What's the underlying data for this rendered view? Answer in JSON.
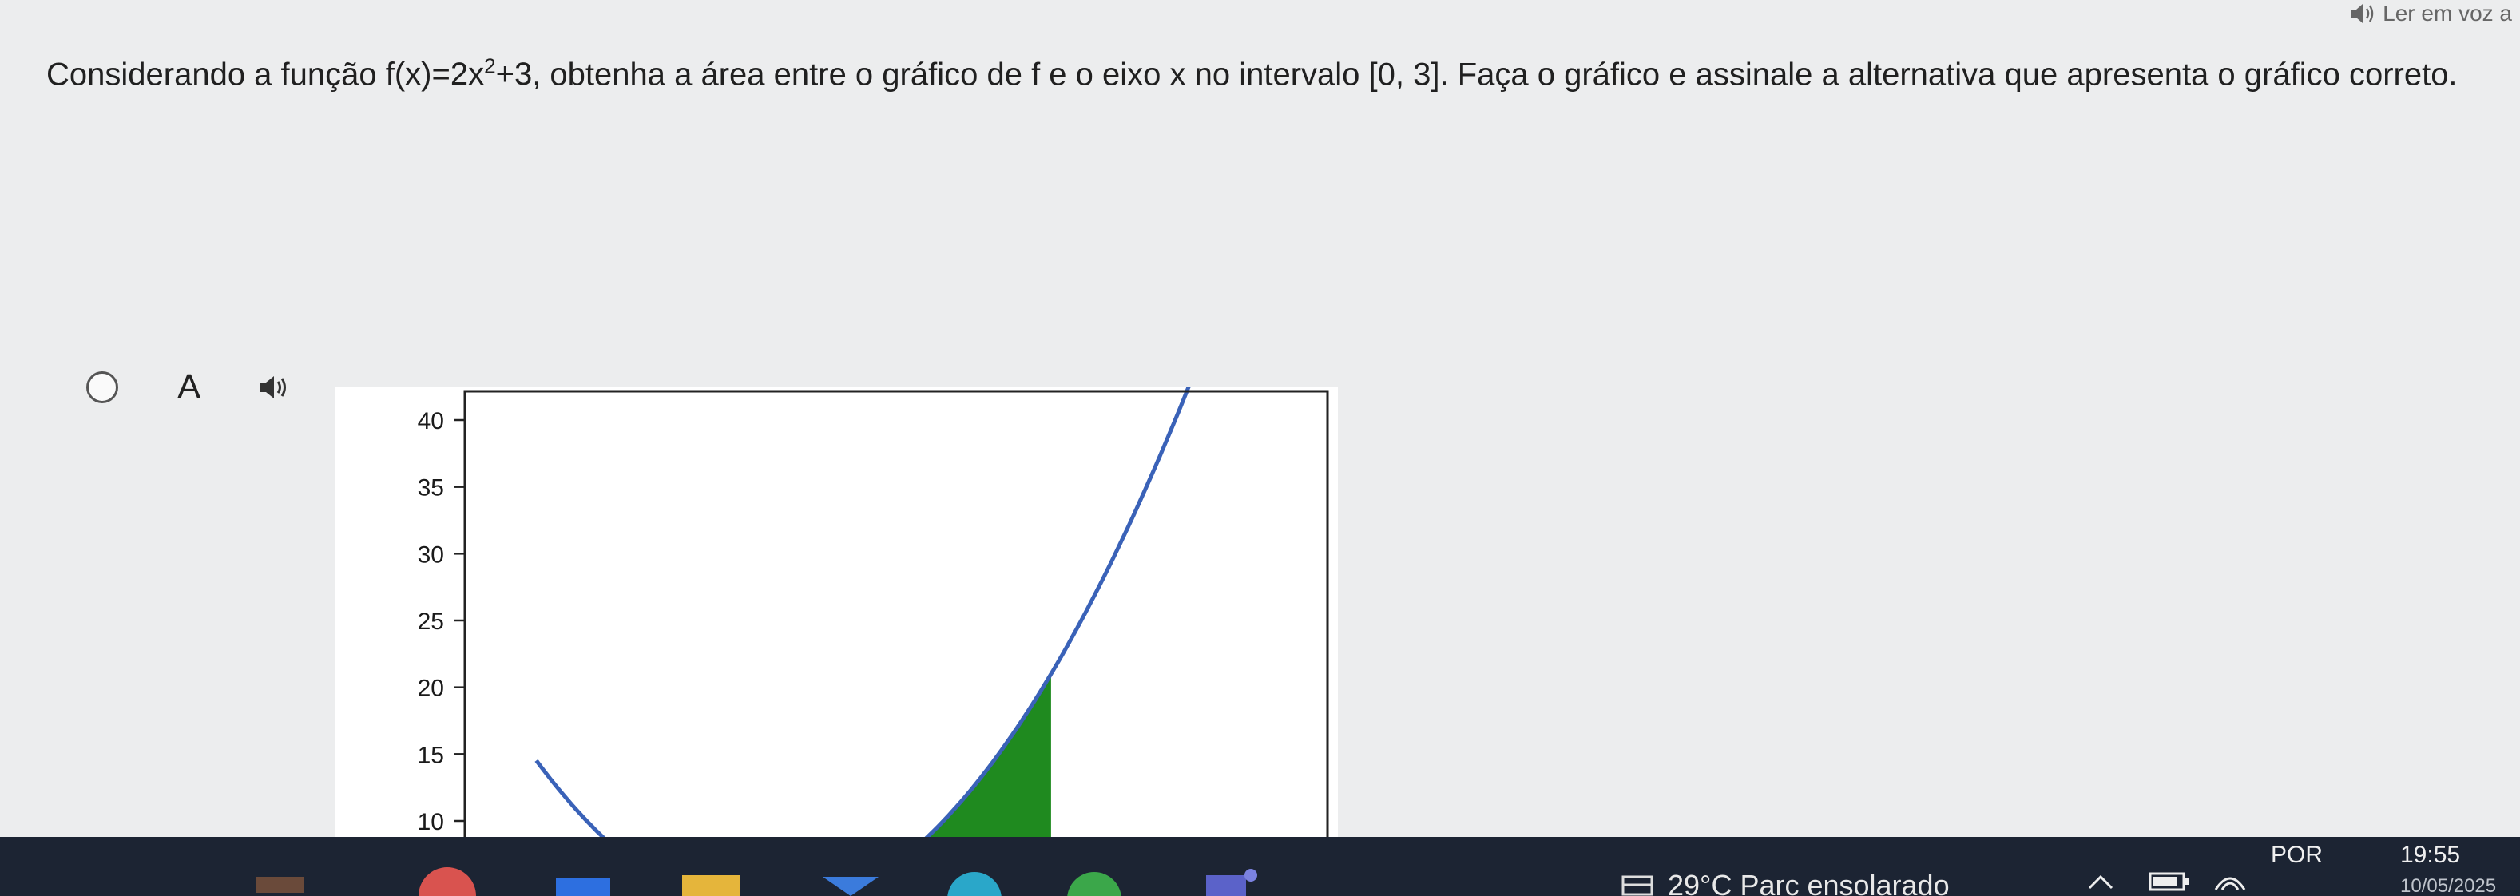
{
  "read_aloud": {
    "label": "Ler em voz a"
  },
  "question": {
    "before": "Considerando a função ",
    "func_left": "f(x)=2x",
    "func_exp": "2",
    "func_right": "+3",
    "middle": ", obtenha a área entre o gráfico de f e o eixo x no intervalo ",
    "interval": "[0, 3]",
    "after": ". Faça o gráfico e assinale a alternativa que apresenta o gráfico correto."
  },
  "option": {
    "letter": "A"
  },
  "chart_data": {
    "type": "area",
    "function": "f(x)=2x^2+3",
    "y_ticks": [
      10,
      15,
      20,
      25,
      30,
      35,
      40
    ],
    "ylim": [
      6.5,
      42
    ],
    "xlim": [
      -3.15,
      5.9
    ],
    "curve": {
      "x_start": -2.4,
      "x_end": 5.35,
      "color": "#3a62b8"
    },
    "shaded_region": {
      "x_from": 0,
      "x_to": 3,
      "color": "#1f8a1f"
    },
    "grid": false
  },
  "taskbar": {
    "weather": "29°C  Parc ensolarado",
    "language": "POR",
    "time": "19:55",
    "date": "10/05/2025"
  }
}
